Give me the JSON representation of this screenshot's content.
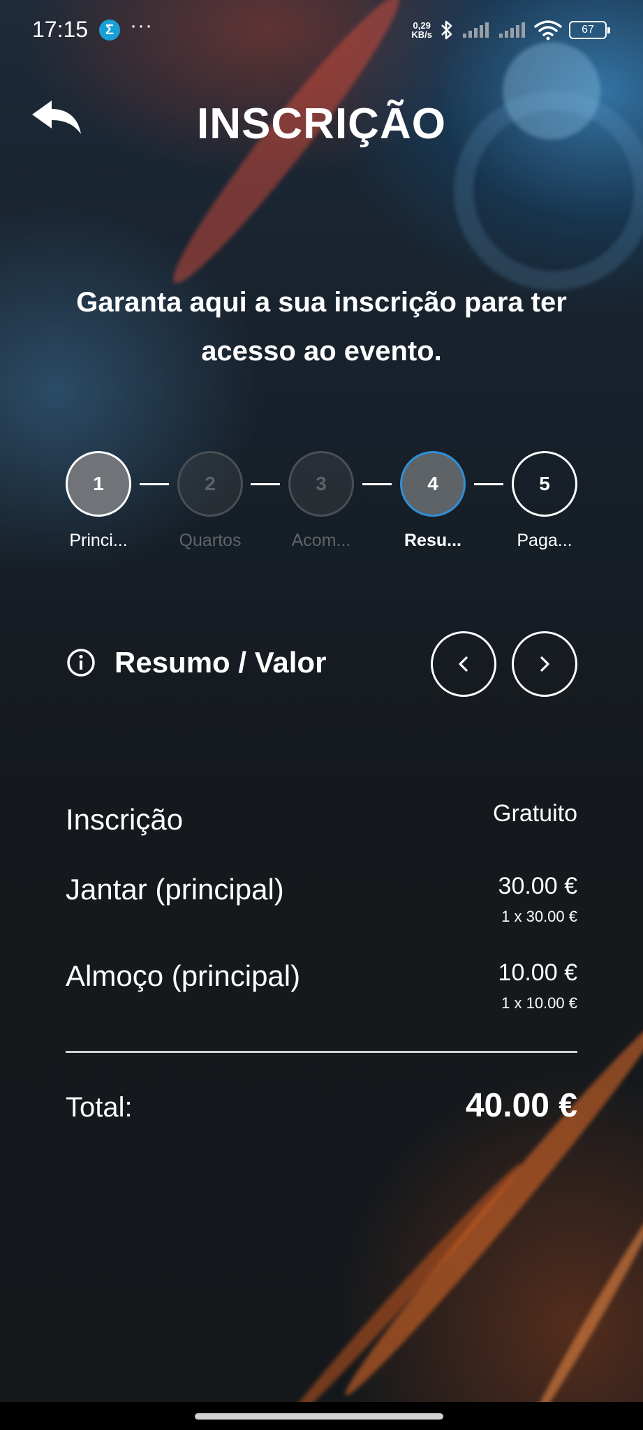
{
  "status_bar": {
    "time": "17:15",
    "app_icon_glyph": "Σ",
    "more": "···",
    "net_speed_value": "0,29",
    "net_speed_unit": "KB/s",
    "battery": "67"
  },
  "header": {
    "title": "INSCRIÇÃO"
  },
  "intro": {
    "text": "Garanta aqui a sua inscrição para ter acesso ao evento."
  },
  "stepper": {
    "steps": [
      {
        "number": "1",
        "label": "Princi...",
        "state": "done"
      },
      {
        "number": "2",
        "label": "Quartos",
        "state": "disabled"
      },
      {
        "number": "3",
        "label": "Acom...",
        "state": "disabled"
      },
      {
        "number": "4",
        "label": "Resu...",
        "state": "active"
      },
      {
        "number": "5",
        "label": "Paga...",
        "state": "pending"
      }
    ]
  },
  "section": {
    "title": "Resumo / Valor"
  },
  "summary": {
    "items": [
      {
        "name": "Inscrição",
        "price": "Gratuito",
        "detail": ""
      },
      {
        "name": "Jantar (principal)",
        "price": "30.00 €",
        "detail": "1 x 30.00 €"
      },
      {
        "name": "Almoço (principal)",
        "price": "10.00 €",
        "detail": "1 x 10.00 €"
      }
    ],
    "total_label": "Total:",
    "total_value": "40.00 €"
  },
  "colors": {
    "active_step_border": "#2e8fd8",
    "text": "#ffffff",
    "app_icon": "#1aa0d8"
  }
}
